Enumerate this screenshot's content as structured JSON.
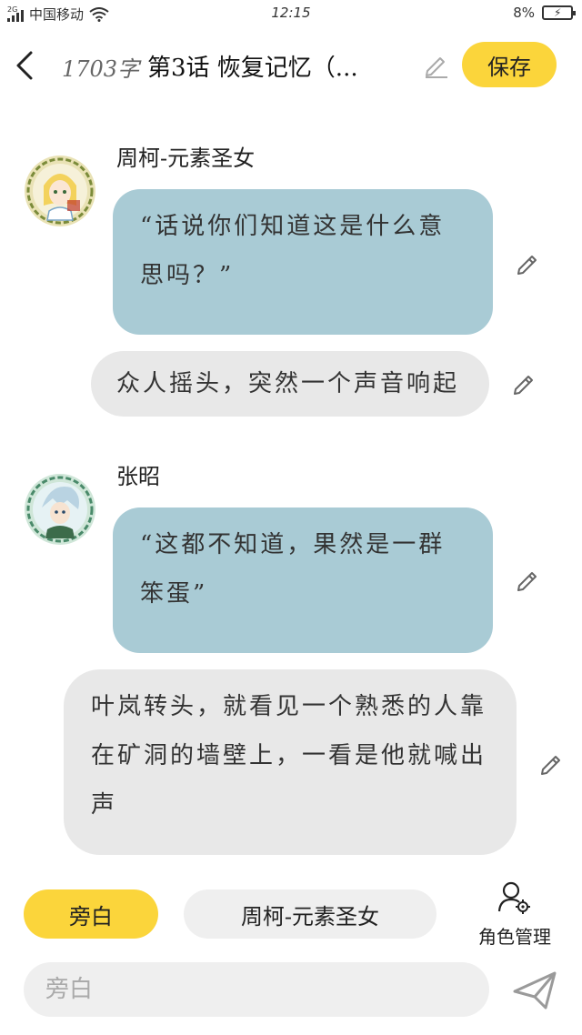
{
  "status_bar": {
    "network": "2G",
    "carrier": "中国移动",
    "time": "12:15",
    "battery": "8%"
  },
  "header": {
    "word_count": "1703字",
    "chapter_title": "第3话  恢复记忆（...",
    "save_label": "保存"
  },
  "messages": [
    {
      "type": "dialog",
      "speaker": "周柯-元素圣女",
      "text": "“话说你们知道这是什么意思吗？”"
    },
    {
      "type": "narration",
      "text": "众人摇头，突然一个声音响起"
    },
    {
      "type": "dialog",
      "speaker": "张昭",
      "text": "“这都不知道，果然是一群笨蛋”"
    },
    {
      "type": "narration",
      "text": "叶岚转头，就看见一个熟悉的人靠在矿洞的墙壁上，一看是他就喊出声"
    }
  ],
  "roles": {
    "narrator_tab": "旁白",
    "character_tab": "周柯-元素圣女",
    "manage_label": "角色管理"
  },
  "input": {
    "placeholder": "旁白"
  },
  "colors": {
    "accent": "#fbd53b",
    "dialog_bubble": "#a9cbd5",
    "narration_bubble": "#e8e8e8"
  }
}
